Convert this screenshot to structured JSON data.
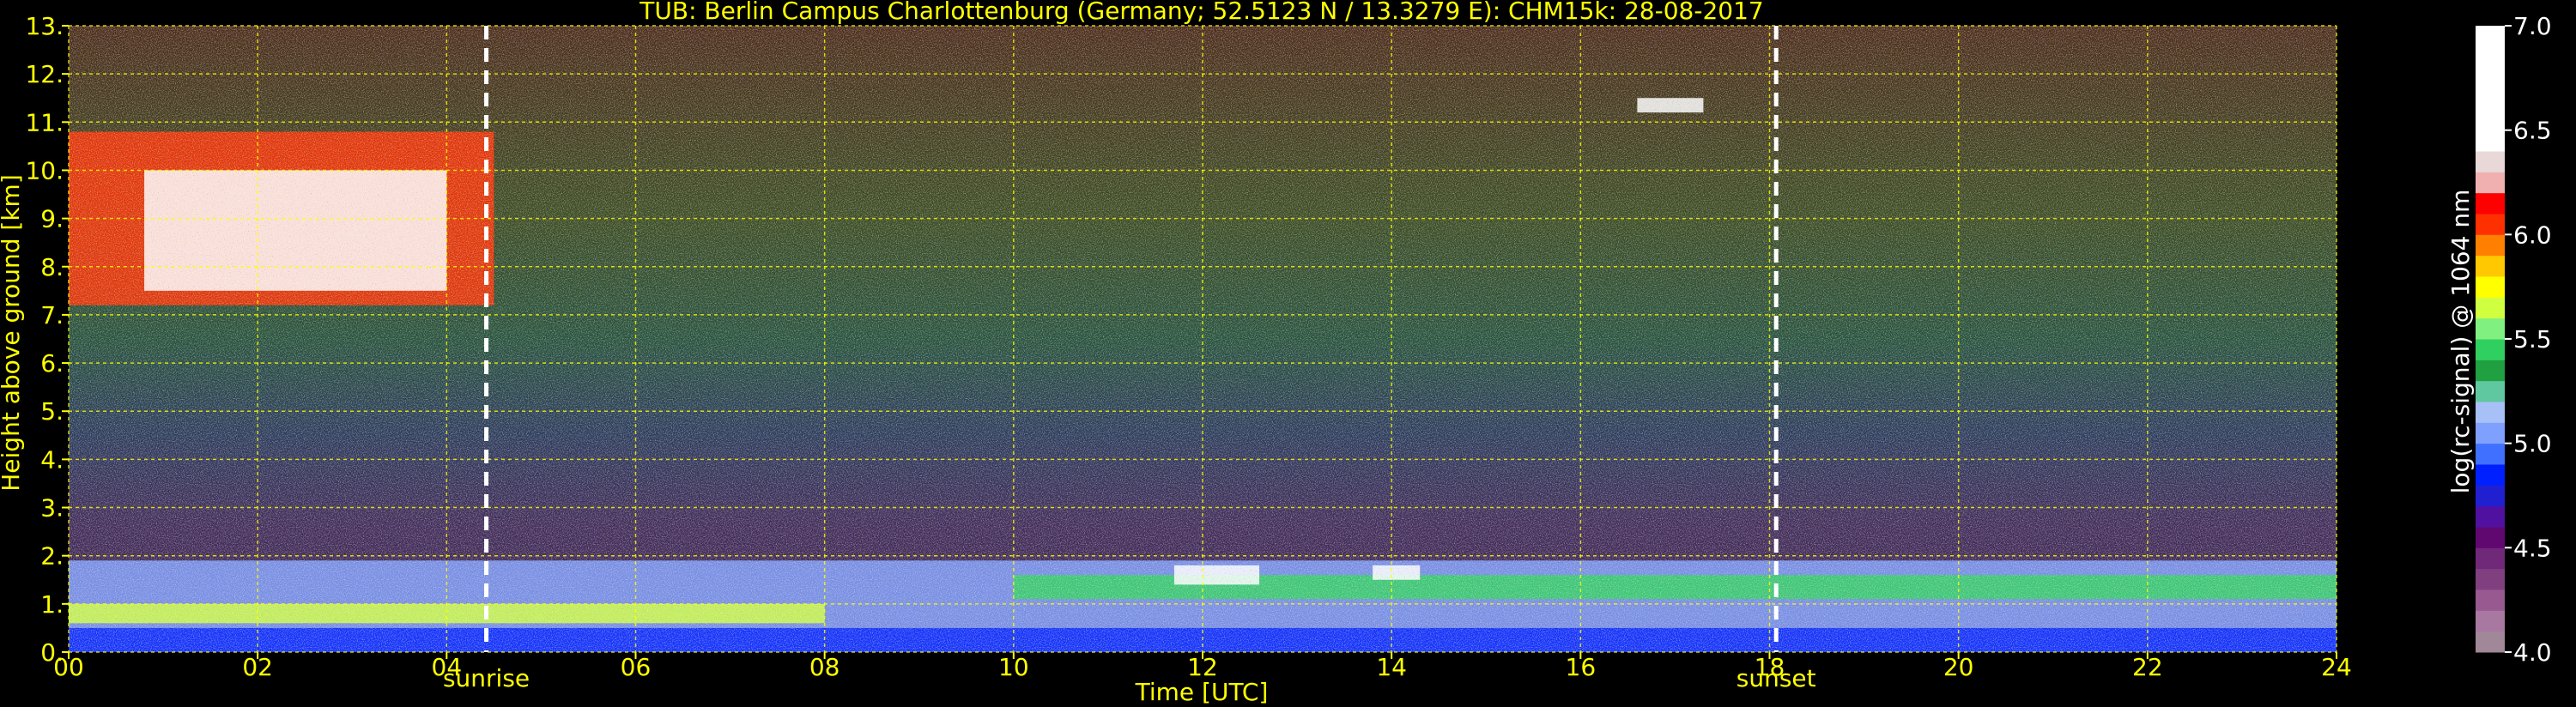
{
  "chart_data": {
    "type": "heatmap",
    "title": "TUB: Berlin Campus Charlottenburg (Germany; 52.5123 N / 13.3279 E):    CHM15k: 28-08-2017",
    "xlabel": "Time [UTC]",
    "ylabel": "Height above ground [km]",
    "xlim": [
      0,
      24
    ],
    "ylim": [
      0,
      13
    ],
    "x_ticks": [
      "00",
      "02",
      "04",
      "06",
      "08",
      "10",
      "12",
      "14",
      "16",
      "18",
      "20",
      "22",
      "24"
    ],
    "y_ticks": [
      "0.",
      "1.",
      "2.",
      "3.",
      "4.",
      "5.",
      "6.",
      "7.",
      "8.",
      "9.",
      "10.",
      "11.",
      "12.",
      "13."
    ],
    "grid": true,
    "grid_color": "#ffff00",
    "text_color": "#ffff00",
    "markers": [
      {
        "label": "sunrise",
        "time": 4.42
      },
      {
        "label": "sunset",
        "time": 18.07
      }
    ],
    "colorbar": {
      "label": "log(rc-signal) @ 1064 nm",
      "range": [
        4.0,
        7.0
      ],
      "ticks": [
        "4.0",
        "4.5",
        "5.0",
        "5.5",
        "6.0",
        "6.5",
        "7.0"
      ],
      "levels": [
        {
          "v": 4.0,
          "c": "#a08898"
        },
        {
          "v": 4.1,
          "c": "#a878a0"
        },
        {
          "v": 4.2,
          "c": "#985890"
        },
        {
          "v": 4.3,
          "c": "#804080"
        },
        {
          "v": 4.4,
          "c": "#702878"
        },
        {
          "v": 4.5,
          "c": "#600870"
        },
        {
          "v": 4.6,
          "c": "#5010a0"
        },
        {
          "v": 4.7,
          "c": "#2020d0"
        },
        {
          "v": 4.8,
          "c": "#0020ff"
        },
        {
          "v": 4.9,
          "c": "#4070ff"
        },
        {
          "v": 5.0,
          "c": "#80a0ff"
        },
        {
          "v": 5.1,
          "c": "#a8c0f8"
        },
        {
          "v": 5.2,
          "c": "#60c8a0"
        },
        {
          "v": 5.3,
          "c": "#20a040"
        },
        {
          "v": 5.4,
          "c": "#30d060"
        },
        {
          "v": 5.5,
          "c": "#80f080"
        },
        {
          "v": 5.6,
          "c": "#d0ff40"
        },
        {
          "v": 5.7,
          "c": "#ffff00"
        },
        {
          "v": 5.8,
          "c": "#ffc800"
        },
        {
          "v": 5.9,
          "c": "#ff8000"
        },
        {
          "v": 6.0,
          "c": "#ff3000"
        },
        {
          "v": 6.1,
          "c": "#ff0000"
        },
        {
          "v": 6.2,
          "c": "#f0b0b0"
        },
        {
          "v": 6.3,
          "c": "#e8d8d8"
        },
        {
          "v": 6.4,
          "c": "#ffffff"
        }
      ]
    },
    "features": [
      {
        "name": "cirrus",
        "t0": 0.0,
        "t1": 4.5,
        "h0": 7.2,
        "h1": 10.8,
        "value": 6.0
      },
      {
        "name": "cirrus-core",
        "t0": 0.8,
        "t1": 4.0,
        "h0": 7.5,
        "h1": 10.0,
        "value": 6.4
      },
      {
        "name": "cloud-patch",
        "t0": 16.6,
        "t1": 17.3,
        "h0": 11.2,
        "h1": 11.5,
        "value": 6.4
      },
      {
        "name": "boundary-layer",
        "t0": 0.0,
        "t1": 24.0,
        "h0": 0.0,
        "h1": 1.9,
        "value": 5.0
      },
      {
        "name": "residual-layer",
        "t0": 0.0,
        "t1": 8.0,
        "h0": 0.6,
        "h1": 1.0,
        "value": 5.6
      },
      {
        "name": "mixed-layer-top",
        "t0": 10.0,
        "t1": 24.0,
        "h0": 1.1,
        "h1": 1.6,
        "value": 5.4
      },
      {
        "name": "surface-layer",
        "t0": 0.0,
        "t1": 24.0,
        "h0": 0.0,
        "h1": 0.5,
        "value": 4.8
      },
      {
        "name": "cumulus-base",
        "t0": 11.7,
        "t1": 12.6,
        "h0": 1.4,
        "h1": 1.8,
        "value": 6.4
      },
      {
        "name": "cumulus-base-2",
        "t0": 13.8,
        "t1": 14.3,
        "h0": 1.5,
        "h1": 1.8,
        "value": 6.4
      }
    ]
  }
}
